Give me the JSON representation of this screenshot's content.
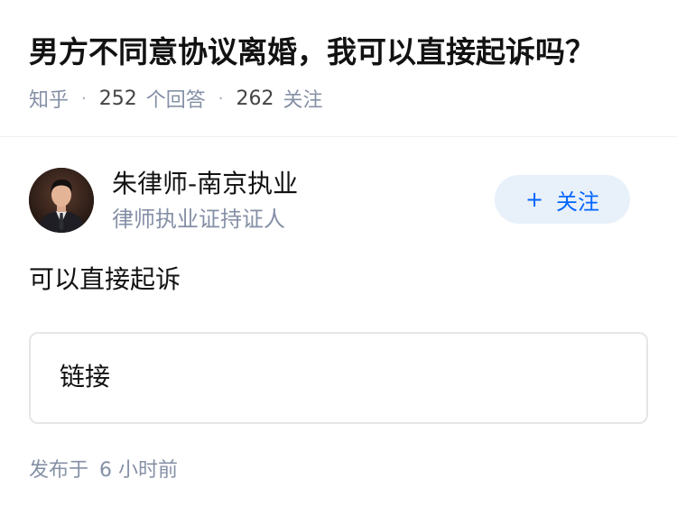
{
  "question": {
    "title": "男方不同意协议离婚，我可以直接起诉吗？",
    "source": "知乎",
    "answer_count": "252",
    "answer_label": "个回答",
    "follower_count": "262",
    "follower_label": "关注",
    "separator": "·"
  },
  "author": {
    "name": "朱律师-南京执业",
    "badge": "律师执业证持证人",
    "follow_plus": "+",
    "follow_label": "关注"
  },
  "answer": {
    "text": "可以直接起诉",
    "link_card_label": "链接",
    "publish_prefix": "发布于",
    "publish_time": "6 小时前"
  },
  "colors": {
    "accent": "#0066ff",
    "follow_bg": "#e8f0fa",
    "meta_gray": "#8590a6",
    "text": "#121212",
    "divider": "#f0f0f0",
    "card_border": "#e6e6e6"
  }
}
